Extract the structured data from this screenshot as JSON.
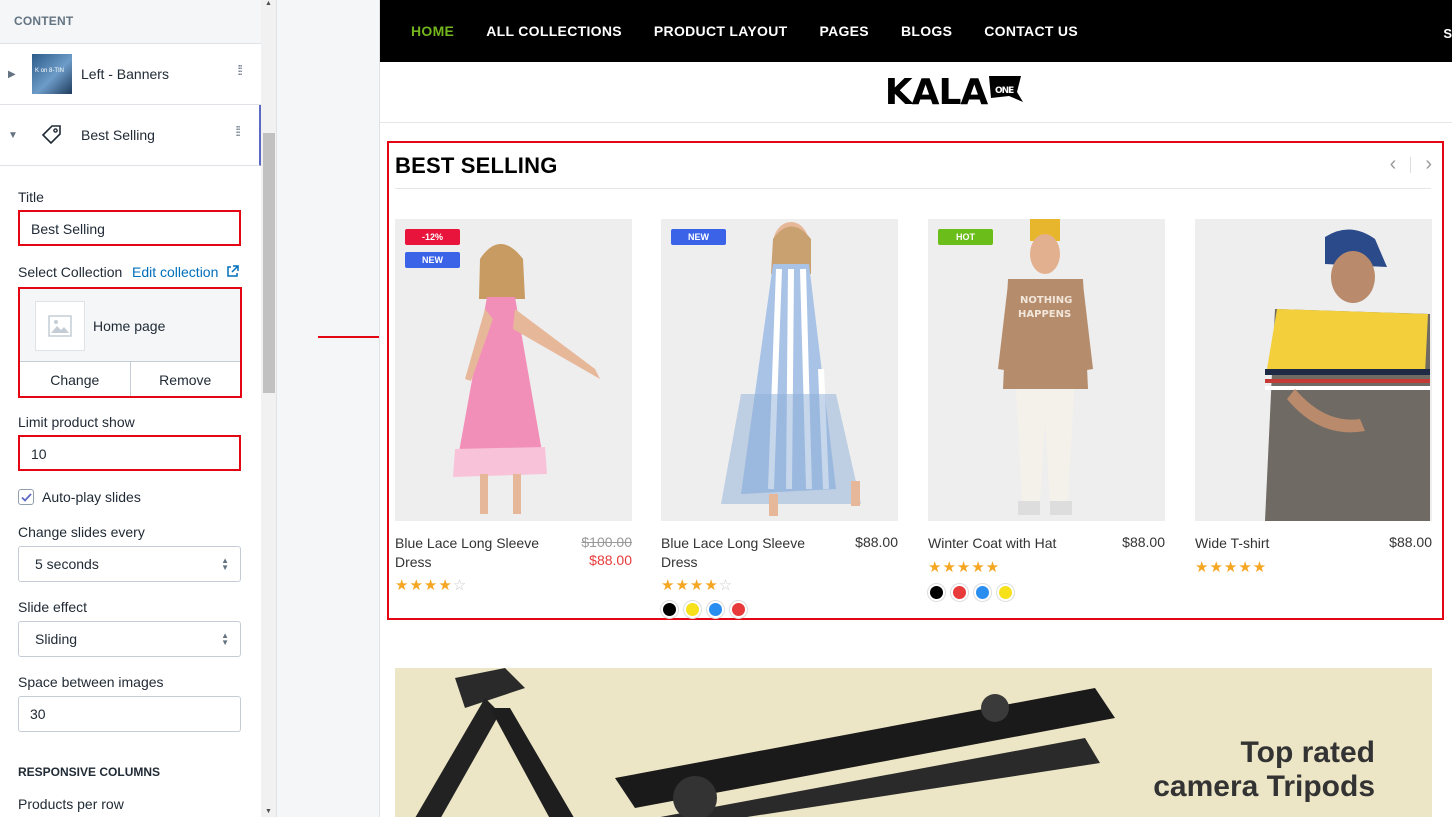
{
  "sidebar": {
    "section_label": "CONTENT",
    "blocks": [
      {
        "label": "Left - Banners",
        "thumb_text": "K on\n8-TIN"
      },
      {
        "label": "Best Selling"
      }
    ],
    "title": {
      "label": "Title",
      "value": "Best Selling"
    },
    "collection": {
      "label": "Select Collection",
      "edit_link": "Edit collection",
      "name": "Home page",
      "change": "Change",
      "remove": "Remove"
    },
    "limit": {
      "label": "Limit product show",
      "value": "10"
    },
    "autoplay": {
      "label": "Auto-play slides",
      "checked": true
    },
    "change_every": {
      "label": "Change slides every",
      "value": "5 seconds"
    },
    "slide_effect": {
      "label": "Slide effect",
      "value": "Sliding"
    },
    "space": {
      "label": "Space between images",
      "value": "30"
    },
    "responsive_heading": "RESPONSIVE COLUMNS",
    "products_per_row": {
      "label": "Products per row"
    }
  },
  "preview": {
    "nav": [
      "HOME",
      "ALL COLLECTIONS",
      "PRODUCT LAYOUT",
      "PAGES",
      "BLOGS",
      "CONTACT US"
    ],
    "nav_edge": "S",
    "logo": "KALA",
    "logo_badge": "ONE",
    "section_title": "BEST SELLING",
    "products": [
      {
        "name": "Blue Lace Long Sleeve Dress",
        "old_price": "$100.00",
        "price": "$88.00",
        "badges": [
          {
            "text": "-12%",
            "color": "#e8143b"
          },
          {
            "text": "NEW",
            "color": "#3b63e8"
          }
        ],
        "rating": 4,
        "swatches": []
      },
      {
        "name": "Blue Lace Long Sleeve Dress",
        "price": "$88.00",
        "badges": [
          {
            "text": "NEW",
            "color": "#3b63e8"
          }
        ],
        "rating": 4,
        "swatches": [
          "#000000",
          "#f6e11b",
          "#2a8ef0",
          "#e83a3a"
        ]
      },
      {
        "name": "Winter Coat with Hat",
        "price": "$88.00",
        "badges": [
          {
            "text": "HOT",
            "color": "#6bbd1a"
          }
        ],
        "rating": 5,
        "swatches": [
          "#000000",
          "#e83a3a",
          "#2a8ef0",
          "#f6e11b"
        ]
      },
      {
        "name": "Wide T-shirt",
        "price": "$88.00",
        "badges": [],
        "rating": 5,
        "swatches": []
      }
    ],
    "banner": {
      "line1": "Top rated",
      "line2": "camera Tripods"
    }
  },
  "colors": {
    "highlight": "#e30613",
    "nav_active": "#73b51e",
    "star": "#f5a623",
    "link": "#006fbb"
  }
}
